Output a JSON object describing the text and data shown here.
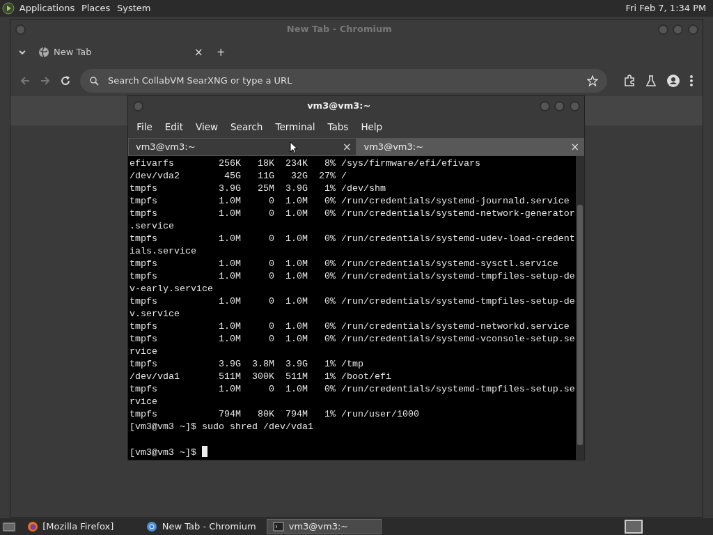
{
  "top_panel": {
    "menus": [
      "Applications",
      "Places",
      "System"
    ],
    "clock": "Fri Feb 7, 1:34 PM"
  },
  "browser": {
    "title": "New Tab - Chromium",
    "tabs": [
      {
        "label": "New Tab",
        "close": "×",
        "selected": true
      }
    ],
    "new_tab": "+",
    "omnibox": {
      "placeholder": "Search CollabVM SearXNG or type a URL"
    }
  },
  "terminal": {
    "title": "vm3@vm3:~",
    "menu": [
      "File",
      "Edit",
      "View",
      "Search",
      "Terminal",
      "Tabs",
      "Help"
    ],
    "tabs": [
      {
        "label": "vm3@vm3:~",
        "close": "×",
        "selected": true
      },
      {
        "label": "vm3@vm3:~",
        "close": "×",
        "selected": false
      }
    ],
    "lines": [
      {
        "kind": "output",
        "text": "efivarfs        256K   18K  234K   8% /sys/firmware/efi/efivars"
      },
      {
        "kind": "output",
        "text": "/dev/vda2        45G   11G   32G  27% /"
      },
      {
        "kind": "output",
        "text": "tmpfs           3.9G   25M  3.9G   1% /dev/shm"
      },
      {
        "kind": "output",
        "text": "tmpfs           1.0M     0  1.0M   0% /run/credentials/systemd-journald.service"
      },
      {
        "kind": "output",
        "text": "tmpfs           1.0M     0  1.0M   0% /run/credentials/systemd-network-generator"
      },
      {
        "kind": "output",
        "text": ".service"
      },
      {
        "kind": "output",
        "text": "tmpfs           1.0M     0  1.0M   0% /run/credentials/systemd-udev-load-credent"
      },
      {
        "kind": "output",
        "text": "ials.service"
      },
      {
        "kind": "output",
        "text": "tmpfs           1.0M     0  1.0M   0% /run/credentials/systemd-sysctl.service"
      },
      {
        "kind": "output",
        "text": "tmpfs           1.0M     0  1.0M   0% /run/credentials/systemd-tmpfiles-setup-de"
      },
      {
        "kind": "output",
        "text": "v-early.service"
      },
      {
        "kind": "output",
        "text": "tmpfs           1.0M     0  1.0M   0% /run/credentials/systemd-tmpfiles-setup-de"
      },
      {
        "kind": "output",
        "text": "v.service"
      },
      {
        "kind": "output",
        "text": "tmpfs           1.0M     0  1.0M   0% /run/credentials/systemd-networkd.service"
      },
      {
        "kind": "output",
        "text": "tmpfs           1.0M     0  1.0M   0% /run/credentials/systemd-vconsole-setup.se"
      },
      {
        "kind": "output",
        "text": "rvice"
      },
      {
        "kind": "output",
        "text": "tmpfs           3.9G  3.8M  3.9G   1% /tmp"
      },
      {
        "kind": "output",
        "text": "/dev/vda1       511M  300K  511M   1% /boot/efi"
      },
      {
        "kind": "output",
        "text": "tmpfs           1.0M     0  1.0M   0% /run/credentials/systemd-tmpfiles-setup.se"
      },
      {
        "kind": "output",
        "text": "rvice"
      },
      {
        "kind": "output",
        "text": "tmpfs           794M   80K  794M   1% /run/user/1000"
      },
      {
        "kind": "output",
        "text": "[vm3@vm3 ~]$ sudo shred /dev/vda1"
      },
      {
        "kind": "blank"
      },
      {
        "kind": "prompt",
        "text": "[vm3@vm3 ~]$",
        "cursor": true
      }
    ]
  },
  "taskbar": {
    "items": [
      {
        "kind": "firefox",
        "label": "[Mozilla Firefox]",
        "selected": false
      },
      {
        "kind": "chromium",
        "label": "New Tab - Chromium",
        "selected": false
      },
      {
        "kind": "terminal",
        "label": "vm3@vm3:~",
        "selected": true
      }
    ]
  }
}
